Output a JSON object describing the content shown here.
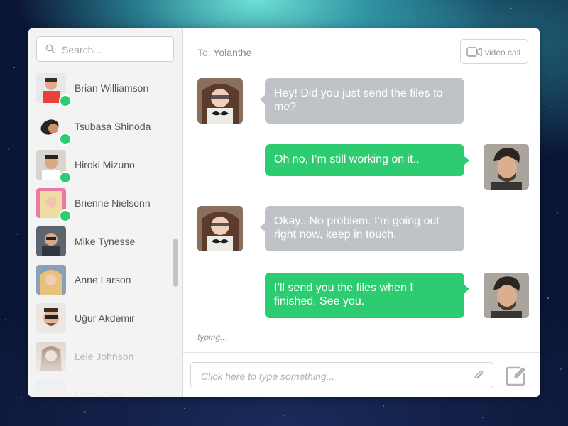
{
  "sidebar": {
    "search": {
      "placeholder": "Search...",
      "icon": "search-icon"
    },
    "contacts": [
      {
        "name": "Brian Williamson",
        "online": true,
        "avatar": "avatar-brian"
      },
      {
        "name": "Tsubasa Shinoda",
        "online": true,
        "avatar": "avatar-tsubasa"
      },
      {
        "name": "Hiroki Mizuno",
        "online": true,
        "avatar": "avatar-hiroki"
      },
      {
        "name": "Brienne Nielsonn",
        "online": true,
        "avatar": "avatar-brienne"
      },
      {
        "name": "Mike Tynesse",
        "online": false,
        "avatar": "avatar-mike"
      },
      {
        "name": "Anne Larson",
        "online": false,
        "avatar": "avatar-anne"
      },
      {
        "name": "Uğur Akdemir",
        "online": false,
        "avatar": "avatar-ugur"
      },
      {
        "name": "Lele Johnson",
        "online": false,
        "avatar": "avatar-lele"
      },
      {
        "name": "Marry Jane",
        "online": false,
        "avatar": "avatar-marry"
      }
    ]
  },
  "header": {
    "to_prefix": "To:",
    "recipient": "Yolanthe",
    "video_call_label": "video call",
    "video_icon": "video-camera-icon"
  },
  "messages": [
    {
      "direction": "in",
      "text": "Hey! Did you just send the files to me?"
    },
    {
      "direction": "out",
      "text": "Oh no, I’m still working on it.."
    },
    {
      "direction": "in",
      "text": "Okay.. No problem. I’m going out right now, keep in touch."
    },
    {
      "direction": "out",
      "text": "I’ll send you the files when I finished. See you."
    }
  ],
  "typing_indicator": "typing...",
  "composer": {
    "placeholder": "Click here to type something...",
    "attach_icon": "paperclip-icon",
    "send_icon": "compose-edit-icon"
  },
  "colors": {
    "accent_green": "#2ecc71",
    "incoming_bubble": "#bfc3c7",
    "sidebar_bg": "#f3f3f3",
    "window_bg": "#ffffff"
  }
}
